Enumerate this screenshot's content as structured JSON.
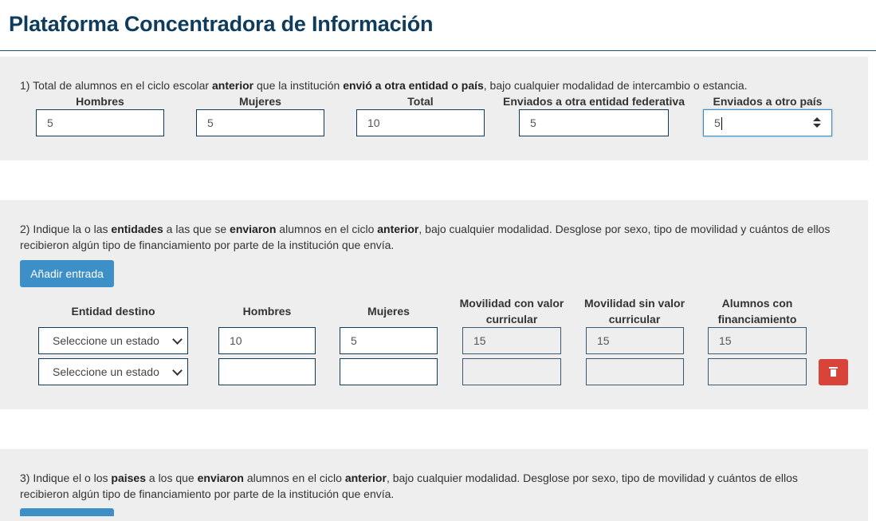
{
  "page": {
    "title": "Plataforma Concentradora de Información"
  },
  "q1": {
    "text_html": "1) Total de alumnos en el ciclo escolar <b>anterior</b> que la institución <b>envió a otra entidad o país</b>, bajo cualquier modalidad de intercambio o estancia.",
    "labels": {
      "hombres": "Hombres",
      "mujeres": "Mujeres",
      "total": "Total",
      "entidad": "Enviados a otra entidad federativa",
      "pais": "Enviados a otro país"
    },
    "values": {
      "hombres": "5",
      "mujeres": "5",
      "total": "10",
      "entidad": "5",
      "pais": "5"
    }
  },
  "q2": {
    "text_html": "2) Indique la o las <b>entidades</b> a las que se <b>enviaron</b> alumnos en el ciclo <b>anterior</b>, bajo cualquier modalidad. Desglose por sexo, tipo de movilidad y cuántos de ellos recibieron algún tipo de financiamiento por parte de la institución que envía.",
    "add_button": "Añadir entrada",
    "headers": {
      "entidad": "Entidad destino",
      "hombres": "Hombres",
      "mujeres": "Mujeres",
      "con_valor": "Movilidad con valor curricular",
      "sin_valor": "Movilidad sin valor curricular",
      "financiamiento": "Alumnos con financiamiento"
    },
    "rows": [
      {
        "estado": "Seleccione un estado",
        "hombres": "10",
        "mujeres": "5",
        "con_valor": "15",
        "sin_valor": "15",
        "financiamiento": "15"
      },
      {
        "estado": "Seleccione un estado",
        "hombres": "",
        "mujeres": "",
        "con_valor": "",
        "sin_valor": "",
        "financiamiento": ""
      }
    ],
    "delete_icon": "trash-icon"
  },
  "q3": {
    "text_html": "3) Indique el o los <b>paises</b> a los que <b>enviaron</b> alumnos en el ciclo <b>anterior</b>, bajo cualquier modalidad. Desglose por sexo, tipo de movilidad y cuántos de ellos recibieron algún tipo de financiamiento por parte de la institución que envía."
  },
  "colors": {
    "title": "#0f3b5c",
    "panel": "#eeeeee",
    "primary": "#3d8fc7",
    "danger": "#d9443a"
  }
}
